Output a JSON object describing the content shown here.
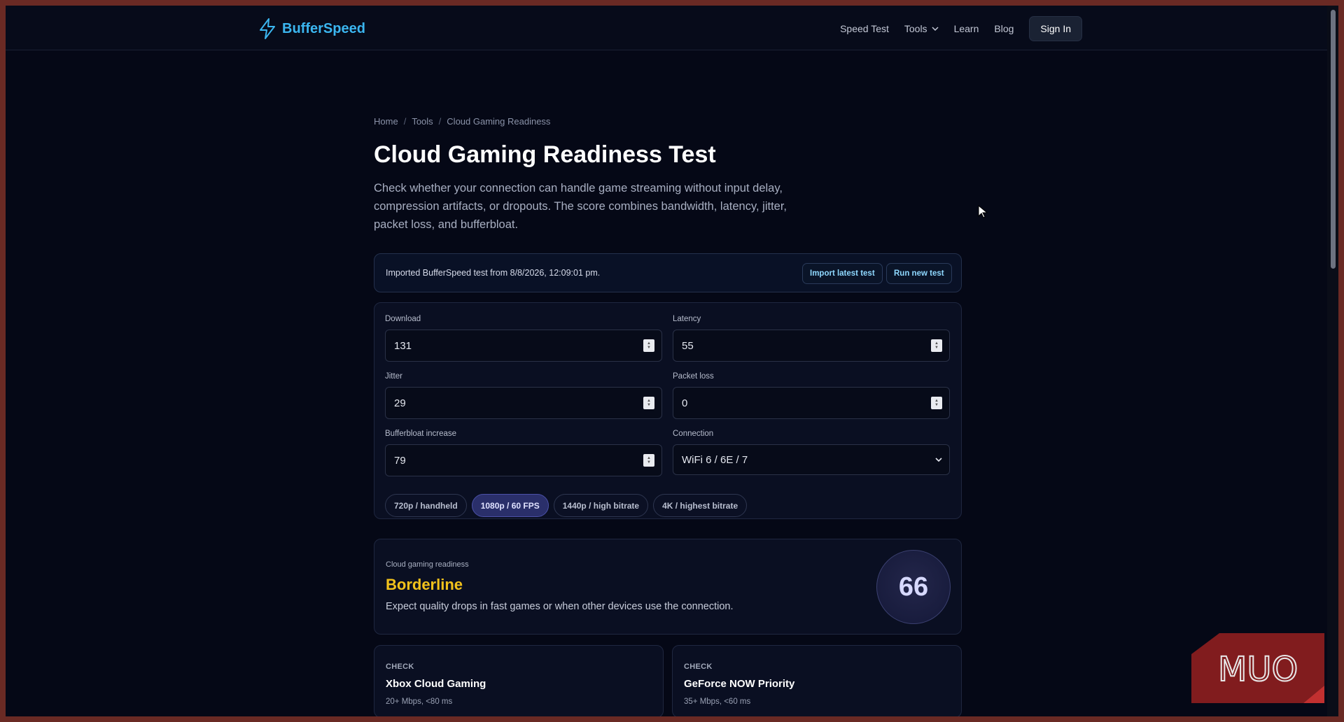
{
  "nav": {
    "brand": "BufferSpeed",
    "links": [
      "Speed Test",
      "Tools",
      "Learn",
      "Blog"
    ],
    "signin": "Sign In"
  },
  "breadcrumb": [
    "Home",
    "Tools",
    "Cloud Gaming Readiness"
  ],
  "page": {
    "title": "Cloud Gaming Readiness Test",
    "lead": "Check whether your connection can handle game streaming without input delay, compression artifacts, or dropouts. The score combines bandwidth, latency, jitter, packet loss, and bufferbloat."
  },
  "import": {
    "text": "Imported BufferSpeed test from 8/8/2026, 12:09:01 pm.",
    "import_btn": "Import latest test",
    "run_btn": "Run new test"
  },
  "fields": {
    "download": {
      "label": "Download",
      "value": "131"
    },
    "latency": {
      "label": "Latency",
      "value": "55"
    },
    "jitter": {
      "label": "Jitter",
      "value": "29"
    },
    "packet_loss": {
      "label": "Packet loss",
      "value": "0"
    },
    "bufferbloat": {
      "label": "Bufferbloat increase",
      "value": "79"
    },
    "connection": {
      "label": "Connection",
      "value": "WiFi 6 / 6E / 7"
    }
  },
  "quality_options": [
    "720p / handheld",
    "1080p / 60 FPS",
    "1440p / high bitrate",
    "4K / highest bitrate"
  ],
  "quality_selected": "1080p / 60 FPS",
  "result": {
    "kicker": "Cloud gaming readiness",
    "status": "Borderline",
    "description": "Expect quality drops in fast games or when other devices use the connection.",
    "score": "66",
    "status_color": "#f2c21b"
  },
  "checks": [
    {
      "kicker": "CHECK",
      "title": "Xbox Cloud Gaming",
      "req": "20+ Mbps, <80 ms"
    },
    {
      "kicker": "CHECK",
      "title": "GeForce NOW Priority",
      "req": "35+ Mbps, <60 ms"
    }
  ],
  "watermark": "MUO",
  "colors": {
    "accent": "#3bb6f0",
    "background": "#050816"
  }
}
